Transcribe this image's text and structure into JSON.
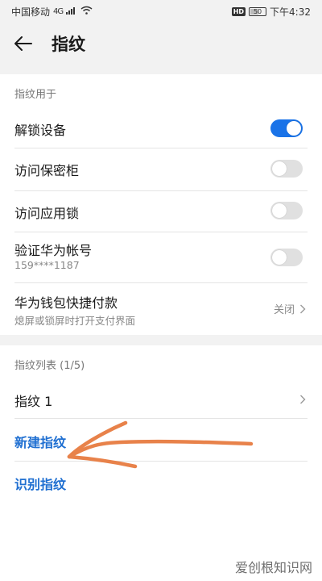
{
  "status_bar": {
    "carrier": "中国移动",
    "network": "4G",
    "hd_badge": "HD",
    "battery": "50",
    "time": "下午4:32"
  },
  "header": {
    "title": "指纹"
  },
  "usage_section": {
    "header": "指纹用于",
    "items": [
      {
        "label": "解锁设备",
        "enabled": true
      },
      {
        "label": "访问保密柜",
        "enabled": false
      },
      {
        "label": "访问应用锁",
        "enabled": false
      },
      {
        "label": "验证华为帐号",
        "sub": "159****1187",
        "enabled": false
      }
    ],
    "wallet": {
      "label": "华为钱包快捷付款",
      "sub": "熄屏或锁屏时打开支付界面",
      "value": "关闭"
    }
  },
  "list_section": {
    "header": "指纹列表 (1/5)",
    "items": [
      {
        "label": "指纹 1"
      }
    ],
    "new_label": "新建指纹",
    "identify_label": "识别指纹"
  },
  "watermark": "爱创根知识网",
  "colors": {
    "accent": "#1a73e8",
    "link": "#1f6fd1",
    "annotation": "#e8824a"
  }
}
